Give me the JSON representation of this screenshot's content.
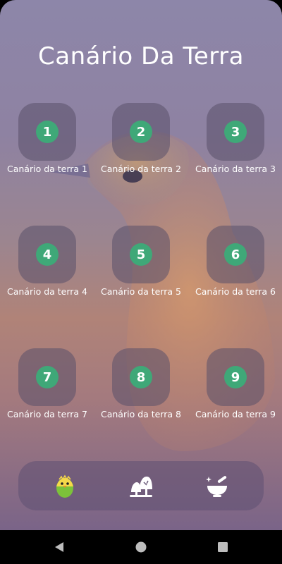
{
  "app": {
    "title": "Canário Da Terra"
  },
  "grid": {
    "items": [
      {
        "number": "1",
        "label": "Canário da terra 1"
      },
      {
        "number": "2",
        "label": "Canário da terra 2"
      },
      {
        "number": "3",
        "label": "Canário da terra 3"
      },
      {
        "number": "4",
        "label": "Canário da terra 4"
      },
      {
        "number": "5",
        "label": "Canário da terra 5"
      },
      {
        "number": "6",
        "label": "Canário da terra 6"
      },
      {
        "number": "7",
        "label": "Canário da terra 7"
      },
      {
        "number": "8",
        "label": "Canário da terra 8"
      },
      {
        "number": "9",
        "label": "Canário da terra 9"
      }
    ]
  },
  "bottom_bar": {
    "tabs": [
      {
        "icon": "bird-egg-icon"
      },
      {
        "icon": "trees-icon"
      },
      {
        "icon": "mortar-pestle-icon"
      }
    ]
  },
  "system_nav": {
    "buttons": [
      "back-icon",
      "home-icon",
      "recents-icon"
    ]
  },
  "colors": {
    "accent_green": "#3fa878",
    "tile_bg": "#5a5069",
    "text": "#ffffff"
  }
}
